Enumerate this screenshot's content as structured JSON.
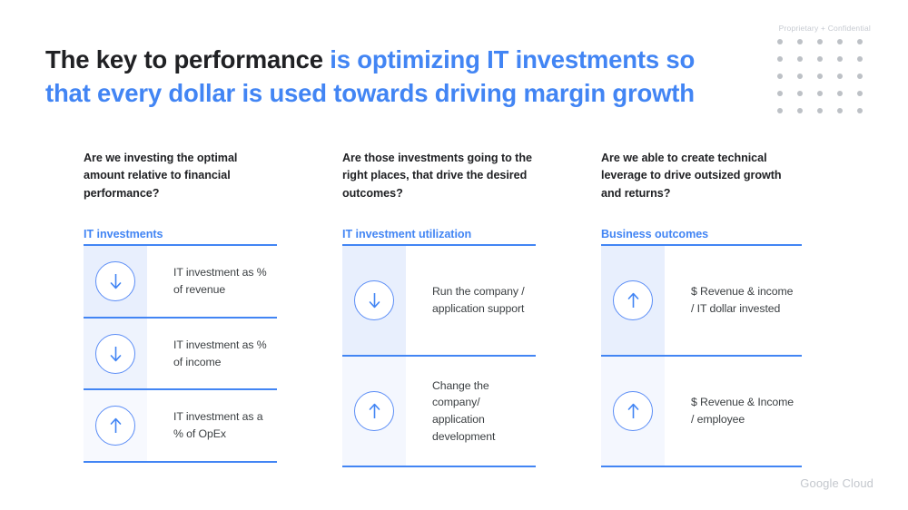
{
  "confidential": {
    "text": "Proprietary + Confidential",
    "dot_count": 25,
    "dot_color": "#bdc1c6"
  },
  "title": {
    "dark_part": "The key to performance ",
    "blue_part": "is optimizing IT investments so that every dollar is used towards driving margin growth",
    "dark_color": "#202124",
    "blue_color": "#4285f4"
  },
  "columns": [
    {
      "question": "Are we investing the optimal amount relative to financial performance?",
      "label": "IT investments",
      "rows": [
        {
          "icon": "arrow-down-icon",
          "direction": "down",
          "text": "IT investment as % of revenue"
        },
        {
          "icon": "arrow-down-icon",
          "direction": "down",
          "text": "IT investment as % of income"
        },
        {
          "icon": "arrow-up-icon",
          "direction": "up",
          "text": "IT investment as a % of OpEx"
        }
      ]
    },
    {
      "question": "Are those investments going to the right places, that drive the desired outcomes?",
      "label": "IT investment utilization",
      "rows": [
        {
          "icon": "arrow-down-icon",
          "direction": "down",
          "text": "Run the company / application support"
        },
        {
          "icon": "arrow-up-icon",
          "direction": "up",
          "text": "Change the company/ application development"
        }
      ]
    },
    {
      "question": "Are we able to create technical leverage to drive outsized growth and returns?",
      "label": "Business outcomes",
      "rows": [
        {
          "icon": "arrow-up-icon",
          "direction": "up",
          "text": "$ Revenue & income / IT dollar invested"
        },
        {
          "icon": "arrow-up-icon",
          "direction": "up",
          "text": "$ Revenue & Income / employee"
        }
      ]
    }
  ],
  "footer": {
    "brand_1": "Google",
    "brand_2": "Cloud"
  },
  "theme": {
    "accent": "#4285f4",
    "text": "#3c4043",
    "heading": "#202124",
    "muted": "#c3c7cd"
  }
}
